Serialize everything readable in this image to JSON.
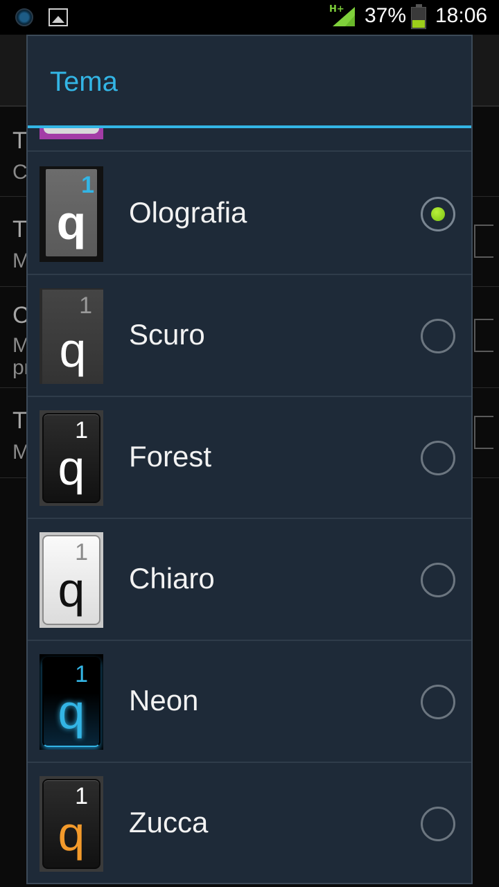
{
  "status_bar": {
    "network_type": "H+",
    "battery_percent": "37%",
    "battery_level": 0.37,
    "time": "18:06",
    "icons": [
      "notification-circle-icon",
      "image-icon",
      "signal-icon",
      "battery-icon"
    ]
  },
  "background": {
    "row_initials": [
      "T",
      "C",
      "T",
      "M",
      "C",
      "M",
      "pr",
      "T",
      "M"
    ]
  },
  "dialog": {
    "title": "Tema",
    "accent_color": "#33b5e5",
    "selected_index": 0,
    "items": [
      {
        "label": "Olografia",
        "key_number": "1",
        "key_letter": "q",
        "checked": true
      },
      {
        "label": "Scuro",
        "key_number": "1",
        "key_letter": "q",
        "checked": false
      },
      {
        "label": "Forest",
        "key_number": "1",
        "key_letter": "q",
        "checked": false
      },
      {
        "label": "Chiaro",
        "key_number": "1",
        "key_letter": "q",
        "checked": false
      },
      {
        "label": "Neon",
        "key_number": "1",
        "key_letter": "q",
        "checked": false
      },
      {
        "label": "Zucca",
        "key_number": "1",
        "key_letter": "q",
        "checked": false
      }
    ]
  }
}
